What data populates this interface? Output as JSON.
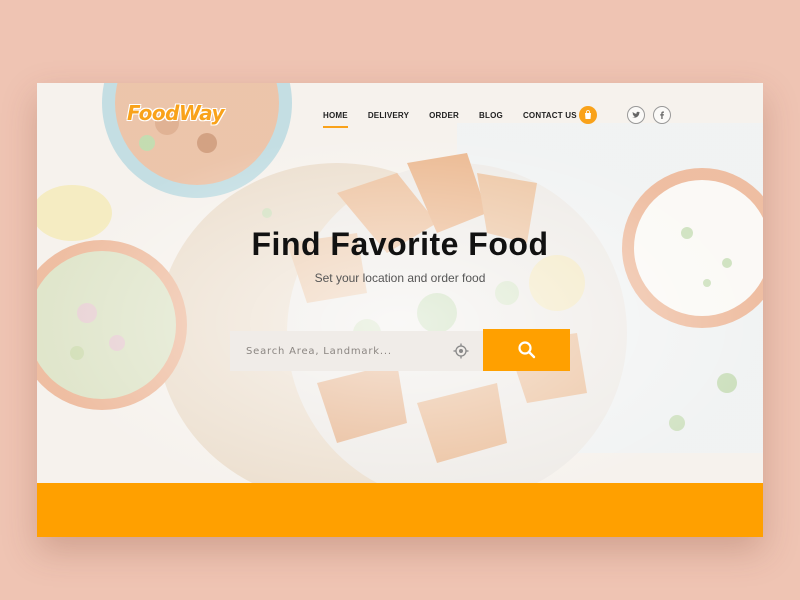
{
  "brand": {
    "logo_text": "FoodWay"
  },
  "nav": {
    "items": [
      {
        "label": "HOME",
        "active": true
      },
      {
        "label": "DELIVERY",
        "active": false
      },
      {
        "label": "ORDER",
        "active": false
      },
      {
        "label": "BLOG",
        "active": false
      },
      {
        "label": "CONTACT US",
        "active": false
      }
    ]
  },
  "header_actions": {
    "cart_icon": "shopping-bag-icon",
    "social": [
      "twitter-icon",
      "facebook-icon"
    ]
  },
  "hero": {
    "title": "Find Favorite Food",
    "subtitle": "Set your location and order food"
  },
  "search": {
    "placeholder": "Search Area, Landmark...",
    "value": "",
    "locate_icon": "location-target-icon",
    "button_icon": "search-icon"
  },
  "colors": {
    "accent": "#ffa000",
    "page_bg": "#efc4b3",
    "text": "#111111"
  }
}
